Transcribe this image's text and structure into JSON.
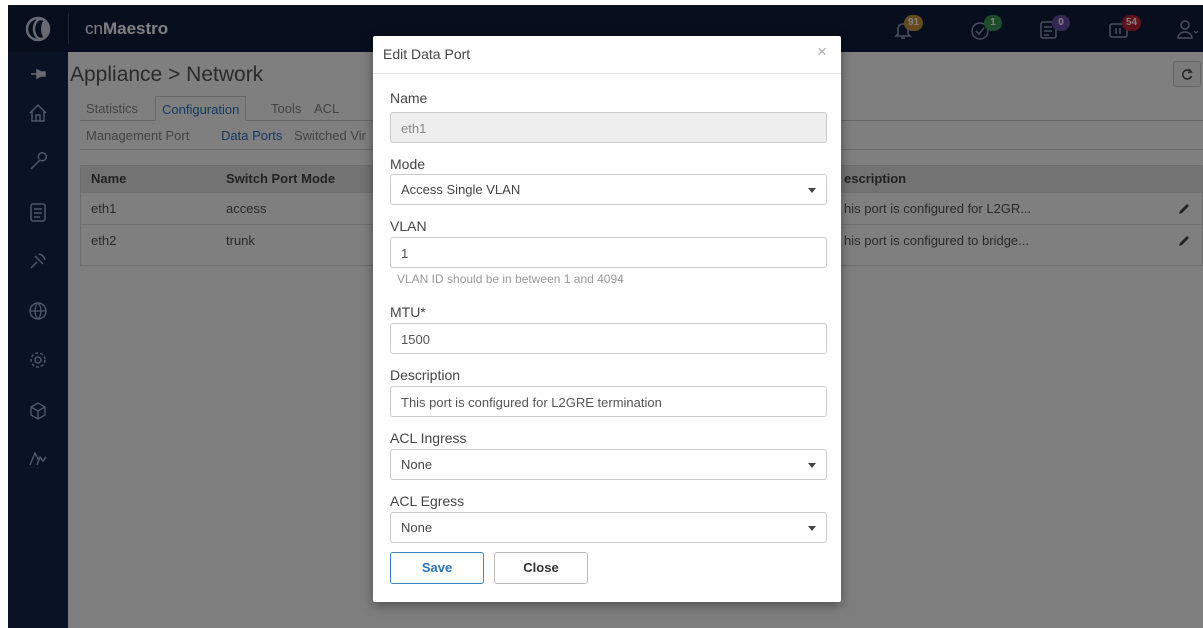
{
  "app": {
    "brand_prefix": "cn",
    "brand_name": "Maestro"
  },
  "notifications": [
    {
      "name": "alarms",
      "count": "91",
      "color": "#c8953a"
    },
    {
      "name": "tasks",
      "count": "1",
      "color": "#3a9a55"
    },
    {
      "name": "jobs",
      "count": "0",
      "color": "#6b4fa8"
    },
    {
      "name": "updates",
      "count": "54",
      "color": "#c0263a"
    }
  ],
  "page": {
    "title": "Appliance > Network"
  },
  "tabs": [
    "Statistics",
    "Configuration",
    "Tools",
    "ACL"
  ],
  "subnav": [
    "Management Port",
    "Data Ports",
    "Switched Vir"
  ],
  "table": {
    "headers": [
      "Name",
      "Switch Port Mode",
      "escription"
    ],
    "rows": [
      {
        "name": "eth1",
        "mode": "access",
        "description": "his port is configured for L2GR..."
      },
      {
        "name": "eth2",
        "mode": "trunk",
        "description": "his port is configured to bridge..."
      }
    ]
  },
  "modal": {
    "title": "Edit Data Port",
    "close_symbol": "×",
    "name_label": "Name",
    "name_value": "eth1",
    "mode_label": "Mode",
    "mode_value": "Access Single VLAN",
    "vlan_label": "VLAN",
    "vlan_value": "1",
    "vlan_help": "VLAN ID should be in between 1 and 4094",
    "mtu_label": "MTU*",
    "mtu_value": "1500",
    "description_label": "Description",
    "description_value": "This port is configured for L2GRE termination",
    "acl_ingress_label": "ACL Ingress",
    "acl_ingress_value": "None",
    "acl_egress_label": "ACL Egress",
    "acl_egress_value": "None",
    "save_label": "Save",
    "close_label": "Close"
  },
  "colors": {
    "topbar": "#0e1f3f",
    "sidebar": "#13264a",
    "accent": "#2a73c0"
  }
}
